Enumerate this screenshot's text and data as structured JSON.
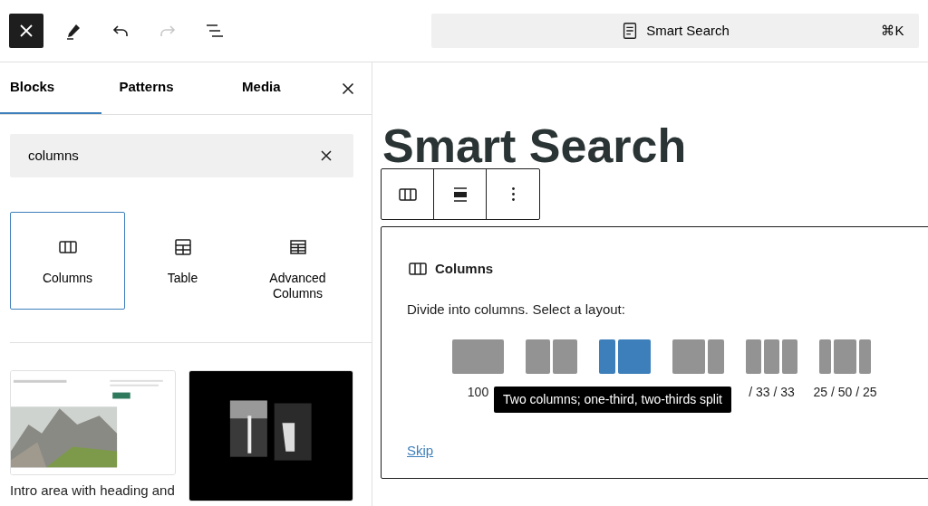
{
  "top_toolbar": {
    "buttons": [
      {
        "kind": "close",
        "active": true
      },
      {
        "kind": "edit",
        "active": false
      },
      {
        "kind": "undo",
        "active": false,
        "disabled": false
      },
      {
        "kind": "redo",
        "active": false,
        "disabled": true
      },
      {
        "kind": "outline",
        "active": false
      }
    ]
  },
  "command_bar": {
    "label": "Smart Search",
    "shortcut": "⌘K"
  },
  "inserter": {
    "tabs": [
      {
        "label": "Blocks",
        "selected": true
      },
      {
        "label": "Patterns",
        "selected": false
      },
      {
        "label": "Media",
        "selected": false
      }
    ],
    "search": {
      "value": "columns"
    },
    "blocks": [
      {
        "label": "Columns",
        "kind": "columns",
        "selected": true
      },
      {
        "label": "Table",
        "kind": "table",
        "selected": false
      },
      {
        "label": "Advanced Columns",
        "kind": "grid",
        "selected": false
      }
    ],
    "patterns": [
      {
        "kind": "picture",
        "caption": "Intro area with heading and"
      },
      {
        "kind": "picture"
      }
    ]
  },
  "canvas": {
    "heading": "Smart Search",
    "block_toolbar": [
      {
        "kind": "columns"
      },
      {
        "kind": "align"
      },
      {
        "kind": "more"
      }
    ],
    "placeholder": {
      "title": "Columns",
      "instructions": "Divide into columns. Select a layout:",
      "variations": [
        {
          "kind": "full",
          "label": "100",
          "selected": false
        },
        {
          "kind": "halves",
          "selected": false
        },
        {
          "kind": "narrowwide",
          "selected": true
        },
        {
          "kind": "widenarrow",
          "selected": false
        },
        {
          "kind": "thirds",
          "label": "/ 33 / 33",
          "selected": false
        },
        {
          "kind": "centerwide",
          "label": "25 / 50 / 25",
          "selected": false
        }
      ],
      "tooltip": "Two columns; one-third, two-thirds split",
      "skip": "Skip"
    }
  }
}
